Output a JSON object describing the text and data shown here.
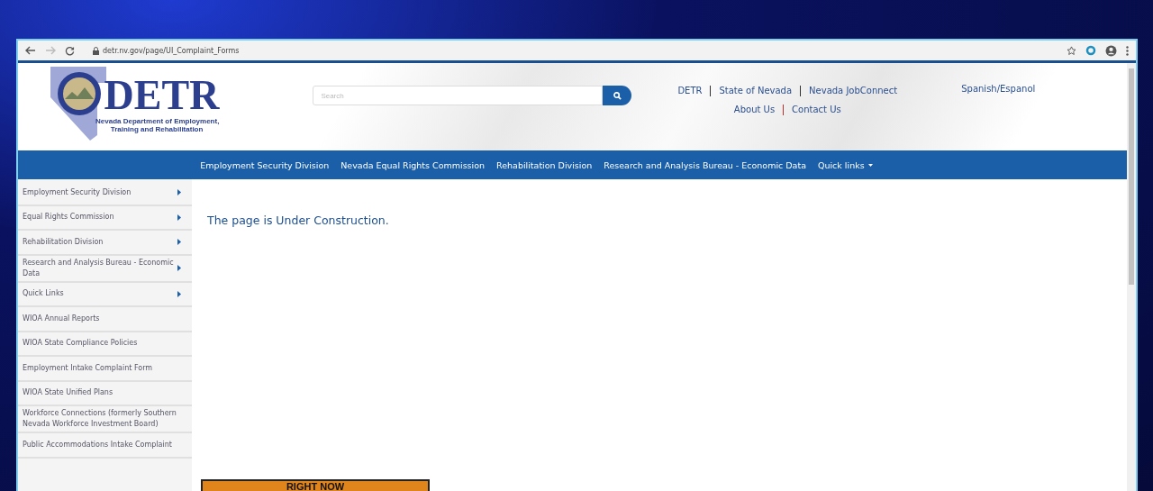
{
  "browser": {
    "url": "detr.nv.gov/page/UI_Complaint_Forms"
  },
  "logo": {
    "wordmark": "DETR",
    "subtitle_line_1": "Nevada Department of Employment,",
    "subtitle_line_2": "Training and Rehabilitation"
  },
  "search": {
    "placeholder": "Search"
  },
  "top_links_row_1": [
    "DETR",
    "State of Nevada",
    "Nevada JobConnect"
  ],
  "top_links_row_2": [
    "About Us",
    "Contact Us"
  ],
  "language_link": "Spanish/Espanol",
  "nav": {
    "items": [
      "Employment Security Division",
      "Nevada Equal Rights Commission",
      "Rehabilitation Division",
      "Research and Analysis Bureau - Economic Data"
    ],
    "dropdown": "Quick links"
  },
  "sidebar": {
    "items": [
      {
        "label": "Employment Security Division",
        "has_submenu": true
      },
      {
        "label": "Equal Rights Commission",
        "has_submenu": true
      },
      {
        "label": "Rehabilitation Division",
        "has_submenu": true
      },
      {
        "label": "Research and Analysis Bureau - Economic Data",
        "has_submenu": true
      },
      {
        "label": "Quick Links",
        "has_submenu": true
      },
      {
        "label": "WIOA Annual Reports",
        "has_submenu": false
      },
      {
        "label": "WIOA State Compliance Policies",
        "has_submenu": false
      },
      {
        "label": "Employment Intake Complaint Form",
        "has_submenu": false
      },
      {
        "label": "WIOA State Unified Plans",
        "has_submenu": false
      },
      {
        "label": "Workforce Connections (formerly Southern Nevada Workforce Investment Board)",
        "has_submenu": false
      },
      {
        "label": "Public Accommodations Intake Complaint",
        "has_submenu": false
      }
    ]
  },
  "content": {
    "message": "The page is Under Construction."
  },
  "banner": {
    "text": "RIGHT NOW"
  }
}
